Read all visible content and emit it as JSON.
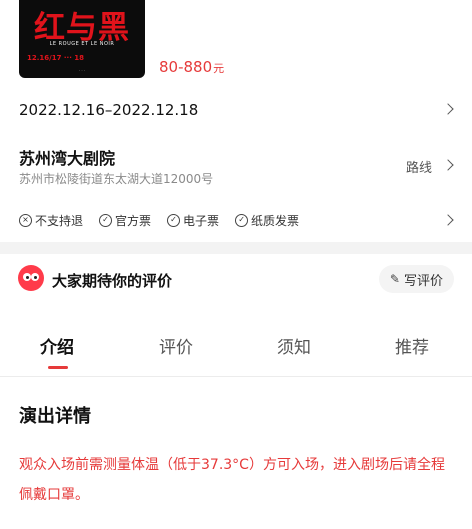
{
  "poster": {
    "title": "红与黑",
    "subtitle": "LE ROUGE ET LE NOIR",
    "dates": "12.16/17 ··· 18",
    "footer": "· · ·"
  },
  "price": {
    "range": "80-880",
    "unit": "元"
  },
  "date_range": "2022.12.16–2022.12.18",
  "venue": {
    "name": "苏州湾大剧院",
    "address": "苏州市松陵街道东太湖大道12000号",
    "route_label": "路线"
  },
  "tags": [
    {
      "label": "不支持退",
      "icon": "x-circle-icon",
      "glyph": "×"
    },
    {
      "label": "官方票",
      "icon": "check-circle-icon",
      "glyph": "✓"
    },
    {
      "label": "电子票",
      "icon": "check-circle-icon",
      "glyph": "✓"
    },
    {
      "label": "纸质发票",
      "icon": "check-circle-icon",
      "glyph": "✓"
    }
  ],
  "review": {
    "title": "大家期待你的评价",
    "write_label": "写评价"
  },
  "tabs": [
    {
      "label": "介绍",
      "active": true
    },
    {
      "label": "评价",
      "active": false
    },
    {
      "label": "须知",
      "active": false
    },
    {
      "label": "推荐",
      "active": false
    }
  ],
  "details": {
    "title": "演出详情",
    "notice": "观众入场前需测量体温（低于37.3°C）方可入场，进入剧场后请全程佩戴口罩。"
  },
  "colors": {
    "accent": "#e63a3a",
    "mascot": "#ff3b4a"
  }
}
